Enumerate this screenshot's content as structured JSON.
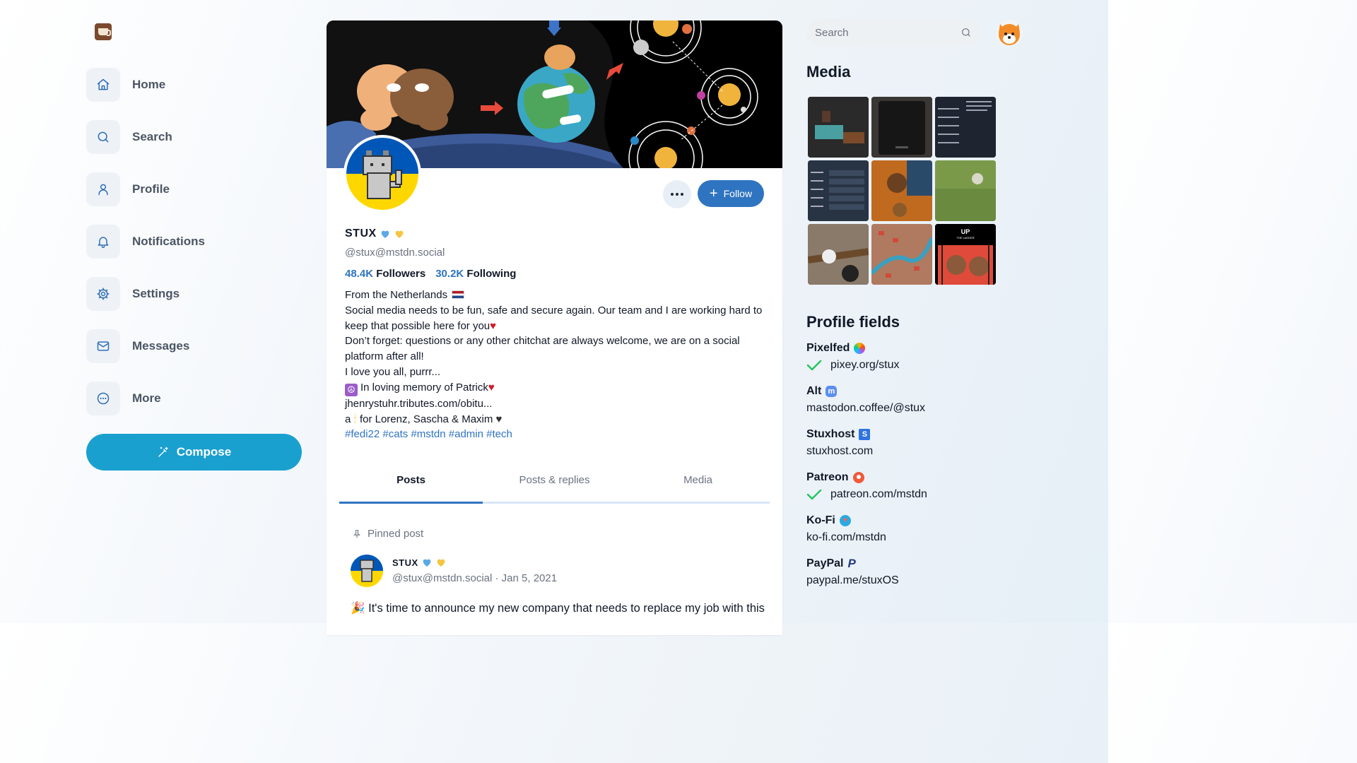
{
  "nav": {
    "items": [
      {
        "label": "Home",
        "icon": "home-icon"
      },
      {
        "label": "Search",
        "icon": "search-icon"
      },
      {
        "label": "Profile",
        "icon": "user-icon"
      },
      {
        "label": "Notifications",
        "icon": "bell-icon"
      },
      {
        "label": "Settings",
        "icon": "gear-icon"
      },
      {
        "label": "Messages",
        "icon": "mail-icon"
      },
      {
        "label": "More",
        "icon": "more-circle-icon"
      }
    ],
    "compose_label": "Compose"
  },
  "profile": {
    "display_name": "STUX",
    "handle": "@stux@mstdn.social",
    "followers_count": "48.4K",
    "followers_label": "Followers",
    "following_count": "30.2K",
    "following_label": "Following",
    "follow_label": "Follow",
    "bio": {
      "line1": "From the Netherlands",
      "line2": "Social media needs to be fun, safe and secure again. Our team and I are working hard to keep that possible here for you",
      "line3": "Don’t forget: questions or any other chitchat are always welcome, we are on a social platform after all!",
      "line4": "I love you all, purrr...",
      "line5": "In loving memory of Patrick",
      "line6": "jhenrystuhr.tributes.com/obitu...",
      "line7a": "a",
      "line7b": "for Lorenz, Sascha & Maxim",
      "hashtags": "#fedi22 #cats #mstdn #admin #tech"
    },
    "colors": {
      "accent": "#2f74c0",
      "compose": "#1aa0cf"
    }
  },
  "tabs": [
    "Posts",
    "Posts & replies",
    "Media"
  ],
  "pinned_post": {
    "pinned_label": "Pinned post",
    "author": "STUX",
    "handle": "@stux@mstdn.social",
    "date": "Jan 5, 2021",
    "meta_sep": "·",
    "text": "It's time to announce my new company that needs to replace my job with this"
  },
  "right": {
    "search_placeholder": "Search",
    "media_title": "Media",
    "profile_fields_title": "Profile fields",
    "fields": [
      {
        "name": "Pixelfed",
        "value": "pixey.org/stux",
        "verified": true
      },
      {
        "name": "Alt",
        "value": "mastodon.coffee/@stux",
        "verified": false
      },
      {
        "name": "Stuxhost",
        "value": "stuxhost.com",
        "verified": false
      },
      {
        "name": "Patreon",
        "value": "patreon.com/mstdn",
        "verified": true
      },
      {
        "name": "Ko-Fi",
        "value": "ko-fi.com/mstdn",
        "verified": false
      },
      {
        "name": "PayPal",
        "value": "paypal.me/stuxOS",
        "verified": false
      }
    ],
    "media_tile_text": {
      "tile9_title": "UP",
      "tile9_sub": "THE LADDER"
    }
  }
}
